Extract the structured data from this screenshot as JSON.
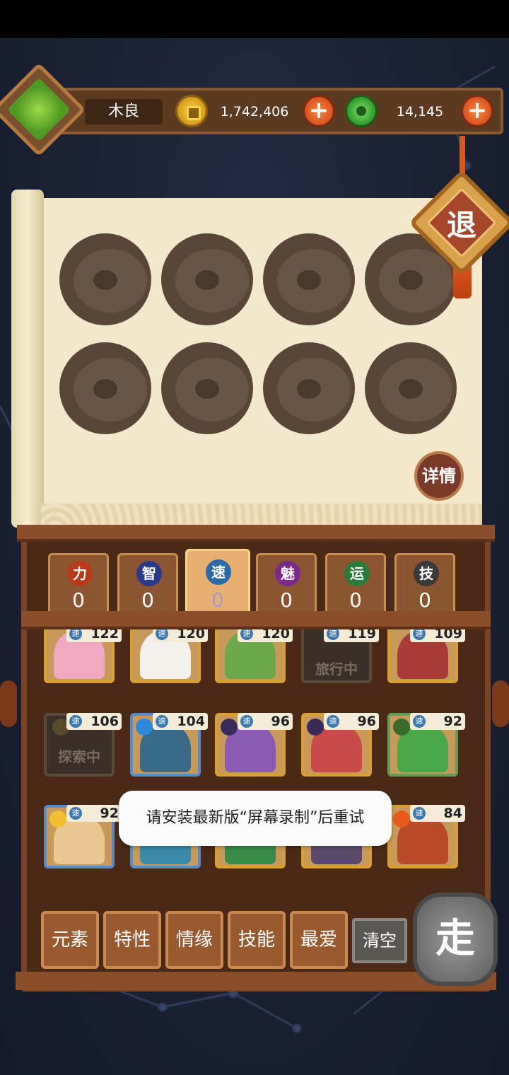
{
  "player": {
    "name": "木良"
  },
  "currency": {
    "gold": "1,742,406",
    "jade": "14,145",
    "plus_label": "+"
  },
  "scroll": {
    "exit_label": "退",
    "detail_label": "详情"
  },
  "stats": [
    {
      "badge": "力",
      "value": "0",
      "color": "#b83a1a"
    },
    {
      "badge": "智",
      "value": "0",
      "color": "#2a3a8a"
    },
    {
      "badge": "速",
      "value": "0",
      "color": "#2a6aa8",
      "active": true
    },
    {
      "badge": "魅",
      "value": "0",
      "color": "#7a2a8a"
    },
    {
      "badge": "运",
      "value": "0",
      "color": "#2a7a3a"
    },
    {
      "badge": "技",
      "value": "0",
      "color": "#3a3a3a"
    }
  ],
  "heroes": {
    "speed_badge": "速",
    "busy_exploring": "探索中",
    "busy_traveling": "旅行中",
    "row1": [
      "122",
      "120",
      "120",
      "119",
      "109"
    ],
    "row2": [
      "106",
      "104",
      "96",
      "96",
      "92"
    ],
    "row3": [
      "92",
      "84"
    ]
  },
  "toast": "请安装最新版“屏幕录制”后重试",
  "filters": [
    "元素",
    "特性",
    "情缘",
    "技能",
    "最爱"
  ],
  "clear_label": "清空",
  "go_label": "走"
}
